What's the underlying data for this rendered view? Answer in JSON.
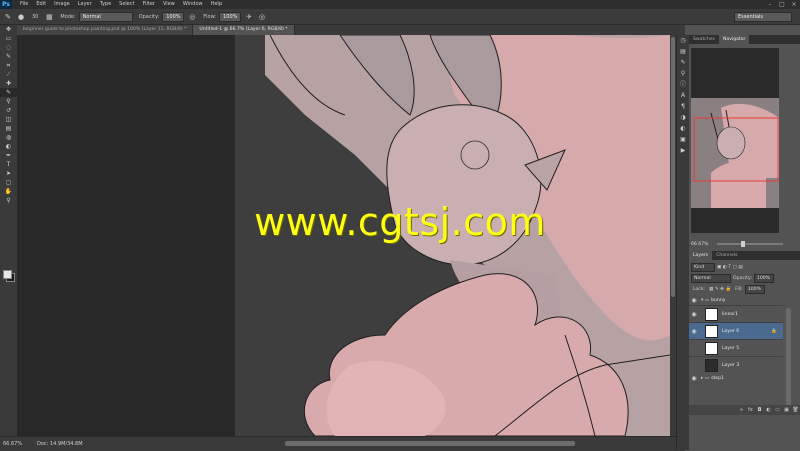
{
  "app": {
    "logo": "Ps"
  },
  "menu": [
    "File",
    "Edit",
    "Image",
    "Layer",
    "Type",
    "Select",
    "Filter",
    "View",
    "Window",
    "Help"
  ],
  "window_controls": [
    "–",
    "□",
    "×"
  ],
  "options": {
    "brush_size": "30",
    "mode_label": "Mode:",
    "mode_value": "Normal",
    "opacity_label": "Opacity:",
    "opacity_value": "100%",
    "flow_label": "Flow:",
    "flow_value": "100%",
    "workspace": "Essentials"
  },
  "tabs": [
    {
      "label": "beginner guide to photoshop painting.psd @ 100% (Layer 11, RGB/8) *",
      "active": false
    },
    {
      "label": "Untitled-1 @ 66.7% (Layer 6, RGB/8) *",
      "active": true
    }
  ],
  "toolbar": {
    "tools": [
      "move",
      "marquee",
      "lasso",
      "quick-select",
      "crop",
      "eyedropper",
      "healing",
      "brush",
      "clone-stamp",
      "history-brush",
      "eraser",
      "gradient",
      "blur",
      "dodge",
      "pen",
      "type",
      "path-select",
      "shape",
      "hand",
      "zoom"
    ],
    "glyphs": [
      "✥",
      "▭",
      "◌",
      "✎",
      "⌗",
      "⟋",
      "✚",
      "✎",
      "⚲",
      "↺",
      "◫",
      "▤",
      "◍",
      "◐",
      "✒",
      "T",
      "➤",
      "▢",
      "✋",
      "⚲"
    ],
    "active_index": 7,
    "fg_color": "#e8e8e8",
    "bg_color": "#1a1a1a"
  },
  "status": {
    "zoom": "66.67%",
    "doc": "Doc: 14.9M/34.8M"
  },
  "panels": {
    "top_tabs": [
      "Swatches",
      "Navigator"
    ],
    "nav_zoom": "66.67%",
    "layer_tabs": [
      "Layers",
      "Channels"
    ],
    "kind_label": "Kind",
    "blend_mode": "Normal",
    "opacity_label": "Opacity:",
    "opacity_value": "100%",
    "lock_label": "Lock:",
    "fill_label": "Fill:",
    "fill_value": "100%",
    "group_top": "bunny",
    "layers": [
      {
        "name": "linear1",
        "thumb": "light",
        "selected": false
      },
      {
        "name": "Layer 6",
        "thumb": "light",
        "selected": true
      },
      {
        "name": "Layer 5",
        "thumb": "light",
        "selected": false
      },
      {
        "name": "Layer 3",
        "thumb": "dark",
        "selected": false
      }
    ],
    "group_bottom": "step1"
  },
  "watermark": "www.cgtsj.com"
}
